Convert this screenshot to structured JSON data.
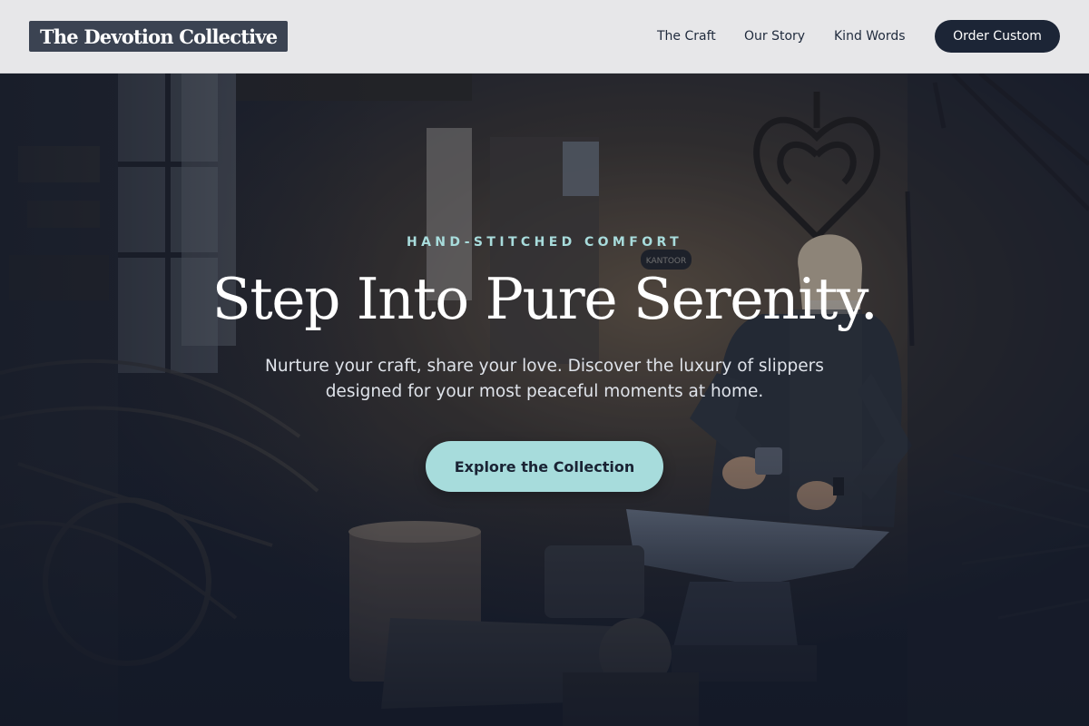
{
  "header": {
    "logo_text": "The Devotion Collective",
    "nav": {
      "craft": "The Craft",
      "story": "Our Story",
      "words": "Kind Words"
    },
    "order_button": "Order Custom"
  },
  "hero": {
    "eyebrow": "HAND-STITCHED COMFORT",
    "headline": "Step Into Pure Serenity.",
    "subtext": "Nurture your craft, share your love. Discover the luxury of slippers designed for your most peaceful moments at home.",
    "cta_button": "Explore the Collection",
    "sign_text": "KANTOOR"
  },
  "colors": {
    "header_bg": "#e7e7e9",
    "logo_bg": "#3b4352",
    "primary_dark": "#1c2536",
    "accent_teal": "#a7dcdc"
  }
}
